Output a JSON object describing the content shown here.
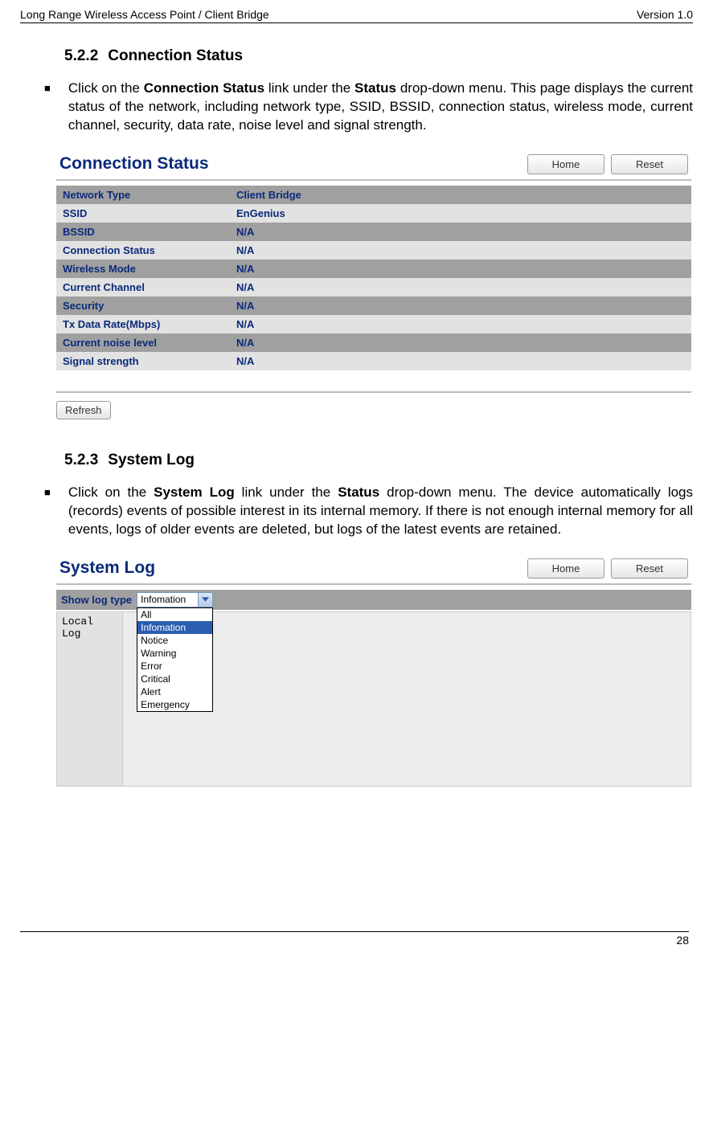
{
  "header": {
    "left": "Long Range Wireless Access Point / Client Bridge",
    "right": "Version 1.0"
  },
  "section1": {
    "number": "5.2.2",
    "title": "Connection Status",
    "bullet_prefix": "Click on the ",
    "bold1": "Connection Status",
    "mid1": " link under the ",
    "bold2": "Status",
    "tail": " drop-down menu. This page displays the current status of the network, including network type, SSID,  BSSID, connection status, wireless mode, current channel, security, data rate, noise level and signal strength."
  },
  "conn_panel": {
    "title": "Connection Status",
    "home": "Home",
    "reset": "Reset",
    "refresh": "Refresh",
    "rows": [
      {
        "label": "Network Type",
        "value": "Client Bridge"
      },
      {
        "label": "SSID",
        "value": "EnGenius"
      },
      {
        "label": "BSSID",
        "value": "N/A"
      },
      {
        "label": "Connection Status",
        "value": "N/A"
      },
      {
        "label": "Wireless Mode",
        "value": "N/A"
      },
      {
        "label": "Current Channel",
        "value": "N/A"
      },
      {
        "label": "Security",
        "value": "N/A"
      },
      {
        "label": "Tx Data Rate(Mbps)",
        "value": "N/A"
      },
      {
        "label": "Current noise level",
        "value": "N/A"
      },
      {
        "label": "Signal strength",
        "value": "N/A"
      }
    ]
  },
  "section2": {
    "number": "5.2.3",
    "title": "System Log",
    "bullet_prefix": "Click on the ",
    "bold1": "System Log",
    "mid1": " link under the ",
    "bold2": "Status",
    "tail": " drop-down menu. The device automatically logs (records) events of possible interest in its internal memory. If there is not enough internal memory for all events, logs of older events are deleted, but logs of the latest events are retained."
  },
  "syslog_panel": {
    "title": "System Log",
    "home": "Home",
    "reset": "Reset",
    "show_label": "Show log type",
    "selected": "Infomation",
    "options": [
      "All",
      "Infomation",
      "Notice",
      "Warning",
      "Error",
      "Critical",
      "Alert",
      "Emergency"
    ],
    "row_label": "Local Log"
  },
  "footer": {
    "page": "28"
  }
}
